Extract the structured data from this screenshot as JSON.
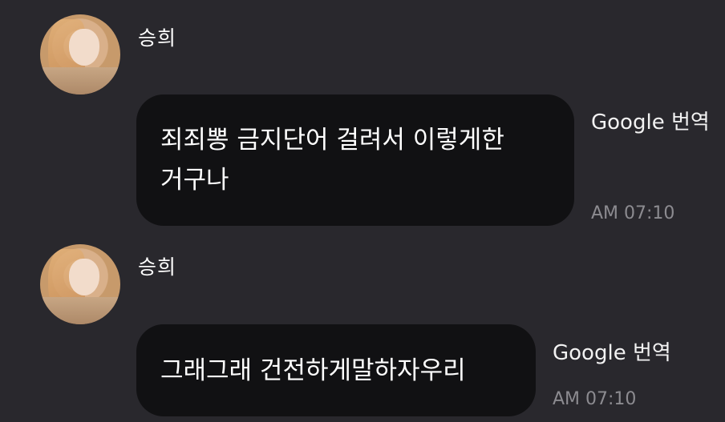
{
  "messages": [
    {
      "sender": "승희",
      "lines": [
        "죄죄뽕 금지단어 걸려서 이렇게한",
        "거구나"
      ],
      "translate_label": "Google 번역",
      "time": "AM 07:10"
    },
    {
      "sender": "승희",
      "lines": [
        "그래그래 건전하게말하자우리"
      ],
      "translate_label": "Google 번역",
      "time": "AM 07:10"
    }
  ],
  "colors": {
    "background": "#29282d",
    "bubble": "#111113",
    "timestamp": "#8c8b90"
  }
}
